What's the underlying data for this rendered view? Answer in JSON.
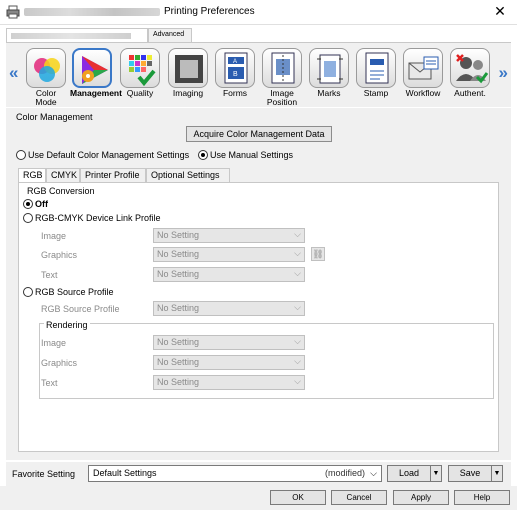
{
  "window": {
    "title": "Printing Preferences",
    "close_glyph": "✕"
  },
  "doc_tabs": {
    "advanced": "Advanced"
  },
  "categories": [
    {
      "label": "Color\nMode",
      "icon": "color-mode-icon"
    },
    {
      "label": "Management",
      "icon": "management-icon"
    },
    {
      "label": "Quality",
      "icon": "quality-icon"
    },
    {
      "label": "Imaging",
      "icon": "imaging-icon"
    },
    {
      "label": "Forms",
      "icon": "forms-icon"
    },
    {
      "label": "Image\nPosition",
      "icon": "image-position-icon"
    },
    {
      "label": "Marks",
      "icon": "marks-icon"
    },
    {
      "label": "Stamp",
      "icon": "stamp-icon"
    },
    {
      "label": "Workflow",
      "icon": "workflow-icon"
    },
    {
      "label": "Authent.",
      "icon": "authentication-icon"
    }
  ],
  "nav": {
    "prev": "«",
    "next": "»"
  },
  "color_management": {
    "group_title": "Color Management",
    "acquire_button": "Acquire Color Management Data",
    "use_default": "Use Default Color Management Settings",
    "use_manual": "Use Manual Settings",
    "selected_mode": "manual"
  },
  "sub_tabs": [
    "RGB",
    "CMYK",
    "Printer Profile",
    "Optional Settings"
  ],
  "rgb": {
    "conversion_title": "RGB Conversion",
    "off": "Off",
    "device_link": "RGB-CMYK Device Link Profile",
    "image_label": "Image",
    "graphics_label": "Graphics",
    "text_label": "Text",
    "no_setting": "No Setting",
    "source_profile": "RGB Source Profile",
    "source_profile_label": "RGB Source Profile",
    "rendering_title": "Rendering"
  },
  "favorite": {
    "label": "Favorite Setting",
    "value": "Default Settings",
    "modified": "(modified)",
    "load": "Load",
    "save": "Save"
  },
  "buttons": {
    "ok": "OK",
    "cancel": "Cancel",
    "apply": "Apply",
    "help": "Help"
  }
}
